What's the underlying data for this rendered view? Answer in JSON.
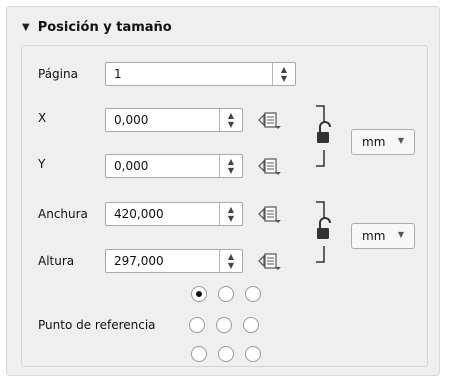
{
  "group": {
    "title": "Posición y tamaño",
    "expanded": true
  },
  "page": {
    "label": "Página",
    "value": "1"
  },
  "position": {
    "x_label": "X",
    "x_value": "0,000",
    "y_label": "Y",
    "y_value": "0,000",
    "unit": "mm",
    "locked": false
  },
  "size": {
    "width_label": "Anchura",
    "width_value": "420,000",
    "height_label": "Altura",
    "height_value": "297,000",
    "unit": "mm",
    "locked": false
  },
  "reference_point": {
    "label": "Punto de referencia",
    "selected": "top-left"
  }
}
